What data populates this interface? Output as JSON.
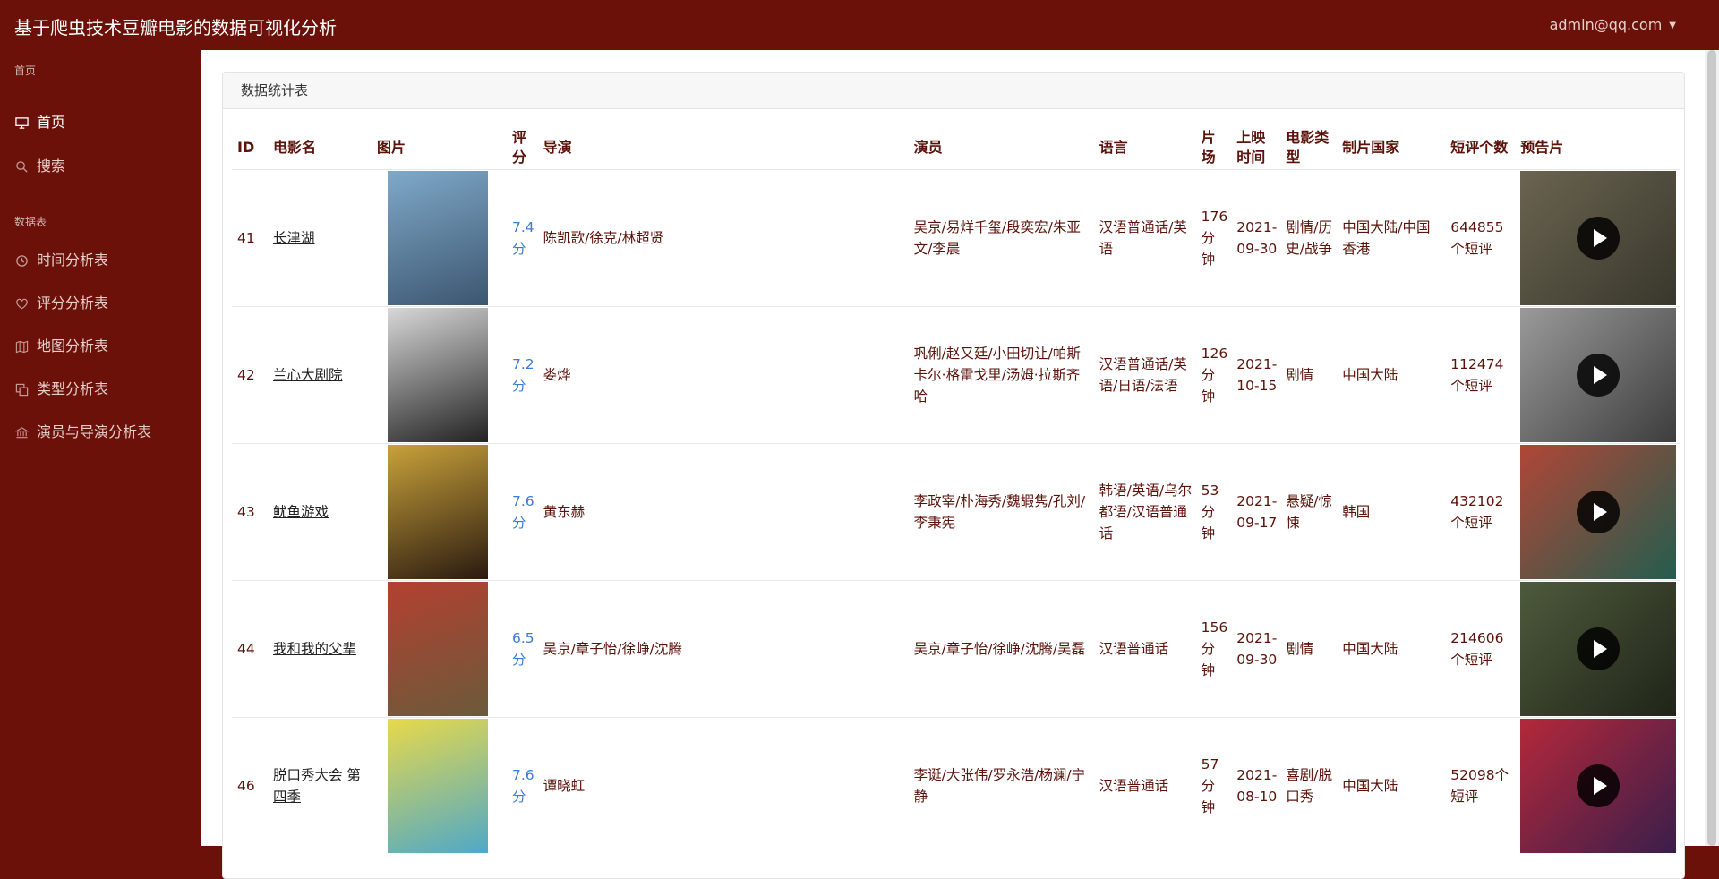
{
  "header": {
    "title": "基于爬虫技术豆瓣电影的数据可视化分析",
    "user": "admin@qq.com",
    "caret_icon": "caret-down-icon"
  },
  "sidebar": {
    "section_home": "首页",
    "items_home": [
      {
        "label": "首页",
        "icon": "monitor-icon",
        "active": true
      },
      {
        "label": "搜索",
        "icon": "search-icon"
      }
    ],
    "section_charts": "数据表",
    "items_charts": [
      {
        "label": "时间分析表",
        "icon": "clock-icon"
      },
      {
        "label": "评分分析表",
        "icon": "heart-icon"
      },
      {
        "label": "地图分析表",
        "icon": "map-icon"
      },
      {
        "label": "类型分析表",
        "icon": "copy-icon"
      },
      {
        "label": "演员与导演分析表",
        "icon": "bank-icon"
      }
    ]
  },
  "card": {
    "title": "数据统计表"
  },
  "table": {
    "headers": [
      "ID",
      "电影名",
      "图片",
      "评分",
      "导演",
      "演员",
      "语言",
      "片场",
      "上映时间",
      "电影类型",
      "制片国家",
      "短评个数",
      "预告片"
    ],
    "rows": [
      {
        "id": "41",
        "title": "长津湖",
        "score": "7.4分",
        "director": "陈凯歌/徐克/林超贤",
        "actors": "吴京/易烊千玺/段奕宏/朱亚文/李晨",
        "language": "汉语普通话/英语",
        "duration": "176分钟",
        "date": "2021-09-30",
        "genre": "剧情/历史/战争",
        "country": "中国大陆/中国香港",
        "comments": "644855个短评",
        "poster_colors": [
          "#7fa9c9",
          "#3c5670"
        ],
        "trailer_colors": [
          "#6a6450",
          "#39372c"
        ]
      },
      {
        "id": "42",
        "title": "兰心大剧院",
        "score": "7.2分",
        "director": "娄烨",
        "actors": "巩俐/赵又廷/小田切让/帕斯卡尔·格雷戈里/汤姆·拉斯齐哈",
        "language": "汉语普通话/英语/日语/法语",
        "duration": "126分钟",
        "date": "2021-10-15",
        "genre": "剧情",
        "country": "中国大陆",
        "comments": "112474个短评",
        "poster_colors": [
          "#d8d8d8",
          "#222222"
        ],
        "trailer_colors": [
          "#9a9a9a",
          "#3d3d3d"
        ]
      },
      {
        "id": "43",
        "title": "鱿鱼游戏",
        "score": "7.6分",
        "director": "黄东赫",
        "actors": "李政宰/朴海秀/魏嘏隽/孔刘/李秉宪",
        "language": "韩语/英语/乌尔都语/汉语普通话",
        "duration": "53分钟",
        "date": "2021-09-17",
        "genre": "悬疑/惊悚",
        "country": "韩国",
        "comments": "432102个短评",
        "poster_colors": [
          "#c9a23a",
          "#2a1a10"
        ],
        "trailer_colors": [
          "#b14636",
          "#235d4e"
        ]
      },
      {
        "id": "44",
        "title": "我和我的父辈",
        "score": "6.5分",
        "director": "吴京/章子怡/徐峥/沈腾",
        "actors": "吴京/章子怡/徐峥/沈腾/吴磊",
        "language": "汉语普通话",
        "duration": "156分钟",
        "date": "2021-09-30",
        "genre": "剧情",
        "country": "中国大陆",
        "comments": "214606个短评",
        "poster_colors": [
          "#b44030",
          "#6b5a3a"
        ],
        "trailer_colors": [
          "#4e5a3c",
          "#1f2418"
        ]
      },
      {
        "id": "46",
        "title": "脱口秀大会 第四季",
        "score": "7.6分",
        "director": "谭晓虹",
        "actors": "李诞/大张伟/罗永浩/杨澜/宁静",
        "language": "汉语普通话",
        "duration": "57分钟",
        "date": "2021-08-10",
        "genre": "喜剧/脱口秀",
        "country": "中国大陆",
        "comments": "52098个短评",
        "poster_colors": [
          "#e8d94a",
          "#4fa8c8"
        ],
        "trailer_colors": [
          "#b4283a",
          "#3a1e4a"
        ]
      }
    ]
  }
}
